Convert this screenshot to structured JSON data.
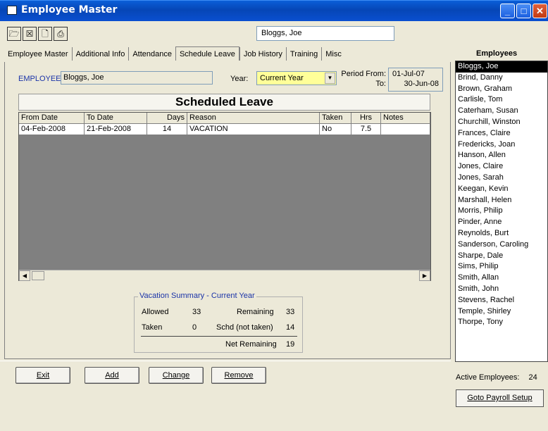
{
  "window": {
    "title": "Employee Master"
  },
  "toolbar": {
    "name_value": "Bloggs, Joe"
  },
  "tabs": [
    "Employee Master",
    "Additional Info",
    "Attendance",
    "Schedule Leave",
    "Job History",
    "Training",
    "Misc"
  ],
  "active_tab": "Schedule Leave",
  "employee": {
    "label": "EMPLOYEE",
    "value": "Bloggs, Joe"
  },
  "year": {
    "label": "Year:",
    "value": "Current Year"
  },
  "period": {
    "from_label": "Period From:",
    "to_label": "To:",
    "from": "01-Jul-07",
    "to": "30-Jun-08"
  },
  "scheduled_leave": {
    "title": "Scheduled Leave",
    "columns": [
      "From Date",
      "To Date",
      "Days",
      "Reason",
      "Taken",
      "Hrs",
      "Notes"
    ],
    "rows": [
      [
        "04-Feb-2008",
        "21-Feb-2008",
        "14",
        "VACATION",
        "No",
        "7.5",
        ""
      ]
    ]
  },
  "summary": {
    "legend": "Vacation Summary - Current Year",
    "allowed_label": "Allowed",
    "allowed": "33",
    "remaining_label": "Remaining",
    "remaining": "33",
    "taken_label": "Taken",
    "taken": "0",
    "schd_label": "Schd (not taken)",
    "schd": "14",
    "net_label": "Net Remaining",
    "net": "19"
  },
  "buttons": {
    "exit": "Exit",
    "add": "Add",
    "change": "Change",
    "remove": "Remove"
  },
  "employees": {
    "title": "Employees",
    "items": [
      "Bloggs, Joe",
      "Brind, Danny",
      "Brown, Graham",
      "Carlisle, Tom",
      "Caterham, Susan",
      "Churchill, Winston",
      "Frances, Claire",
      "Fredericks, Joan",
      "Hanson, Allen",
      "Jones, Claire",
      "Jones, Sarah",
      "Keegan, Kevin",
      "Marshall, Helen",
      "Morris, Philip",
      "Pinder, Anne",
      "Reynolds, Burt",
      "Sanderson, Caroling",
      "Sharpe, Dale",
      "Sims, Philip",
      "Smith, Allan",
      "Smith, John",
      "Stevens, Rachel",
      "Temple, Shirley",
      "Thorpe, Tony"
    ],
    "selected": "Bloggs, Joe",
    "active_label": "Active Employees:",
    "active_count": "24",
    "payroll_button": "Goto Payroll Setup"
  }
}
